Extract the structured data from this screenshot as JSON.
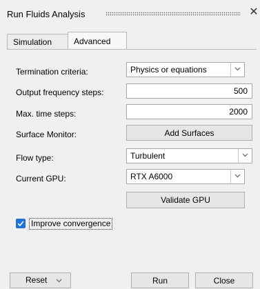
{
  "window": {
    "title": "Run Fluids Analysis",
    "close_glyph": "✕"
  },
  "tabs": [
    {
      "label": "Simulation",
      "active": false
    },
    {
      "label": "Advanced",
      "active": true
    }
  ],
  "form": {
    "termination": {
      "label": "Termination criteria:",
      "value": "Physics or equations"
    },
    "output_frequency": {
      "label": "Output frequency steps:",
      "value": "500"
    },
    "max_time_steps": {
      "label": "Max. time steps:",
      "value": "2000"
    },
    "surface_monitor": {
      "label": "Surface Monitor:",
      "button": "Add Surfaces"
    },
    "flow_type": {
      "label": "Flow type:",
      "value": "Turbulent"
    },
    "current_gpu": {
      "label": "Current GPU:",
      "value": "RTX A6000"
    },
    "validate_gpu": {
      "button": "Validate GPU"
    },
    "improve_convergence": {
      "label": "Improve convergence",
      "checked": true
    }
  },
  "footer": {
    "reset": "Reset",
    "run": "Run",
    "close": "Close"
  },
  "colors": {
    "accent": "#1f73d6",
    "background": "#f0f0f0"
  }
}
